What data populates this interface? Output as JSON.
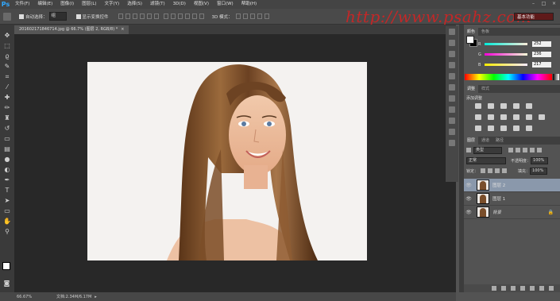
{
  "app": {
    "logo": "Ps"
  },
  "menu": [
    "文件(F)",
    "编辑(E)",
    "图像(I)",
    "图层(L)",
    "文字(Y)",
    "选择(S)",
    "滤镜(T)",
    "3D(D)",
    "视图(V)",
    "窗口(W)",
    "帮助(H)"
  ],
  "window_controls": [
    "–",
    "□",
    "×"
  ],
  "options": {
    "auto_select_label": "自动选择：",
    "auto_select_value": "组",
    "show_transform_label": "显示变换控件",
    "mode_3d_label": "3D 模式：",
    "workspace": "基本功能",
    "watermark": "http://www.psahz.com"
  },
  "document": {
    "tab_title": "201602171846714.jpg @ 66.7% (图层 2, RGB/8) *",
    "tab_close": "×"
  },
  "status": {
    "zoom": "66.67%",
    "doc_info": "文档:2.34M/6.17M",
    "arrow": "▸"
  },
  "color_panel": {
    "tabs": [
      "颜色",
      "色板"
    ],
    "R": "252",
    "G": "236",
    "B": "217",
    "labels": [
      "R",
      "G",
      "B"
    ],
    "colors": {
      "fg": "#fcfcfc",
      "bg": "#000000"
    }
  },
  "adjustments_panel": {
    "tabs": [
      "调整",
      "样式"
    ],
    "title": "添加调整"
  },
  "layers_panel": {
    "tabs": [
      "图层",
      "通道",
      "路径"
    ],
    "kind": "类型",
    "blend_mode": "正常",
    "opacity_label": "不透明度：",
    "opacity_value": "100%",
    "lock_label": "锁定：",
    "fill_label": "填充：",
    "fill_value": "100%",
    "layers": [
      {
        "name": "图层 2",
        "selected": true,
        "locked": false
      },
      {
        "name": "图层 1",
        "selected": false,
        "locked": false
      },
      {
        "name": "背景",
        "selected": false,
        "locked": true
      }
    ]
  },
  "tools": [
    "move-tool",
    "marquee-tool",
    "lasso-tool",
    "quick-select-tool",
    "crop-tool",
    "eyedropper-tool",
    "healing-brush-tool",
    "brush-tool",
    "clone-stamp-tool",
    "history-brush-tool",
    "eraser-tool",
    "gradient-tool",
    "blur-tool",
    "dodge-tool",
    "pen-tool",
    "type-tool",
    "path-select-tool",
    "shape-tool",
    "hand-tool",
    "zoom-tool"
  ]
}
